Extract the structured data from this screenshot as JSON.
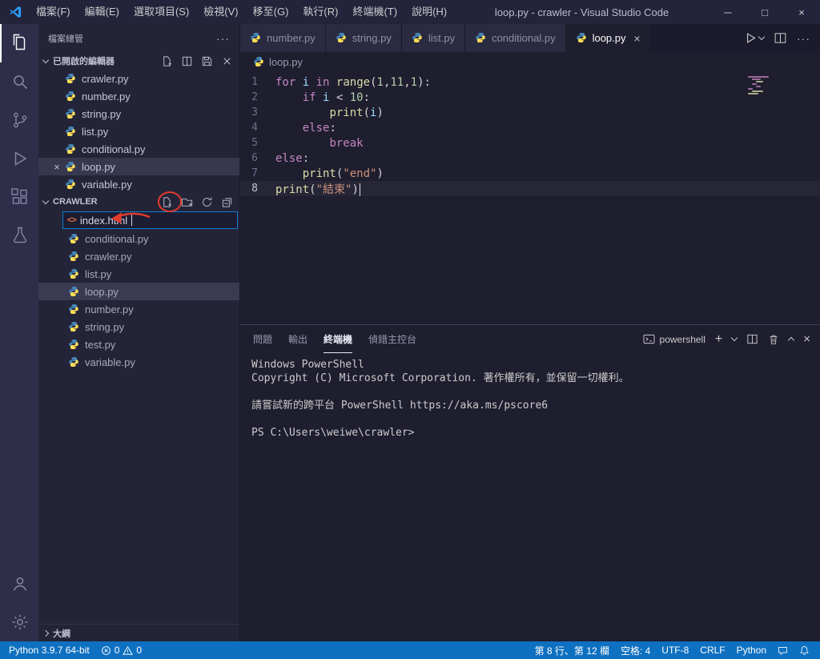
{
  "title_bar": {
    "menus": [
      "檔案(F)",
      "編輯(E)",
      "選取項目(S)",
      "檢視(V)",
      "移至(G)",
      "執行(R)",
      "終端機(T)",
      "說明(H)"
    ],
    "title": "loop.py - crawler - Visual Studio Code"
  },
  "sidebar": {
    "header": "檔案總管",
    "open_editors": {
      "label": "已開啟的編輯器",
      "items": [
        {
          "label": "crawler.py"
        },
        {
          "label": "number.py"
        },
        {
          "label": "string.py"
        },
        {
          "label": "list.py"
        },
        {
          "label": "conditional.py"
        },
        {
          "label": "loop.py",
          "active": true
        },
        {
          "label": "variable.py"
        }
      ]
    },
    "project": {
      "label": "CRAWLER",
      "new_file_value": "index.html",
      "items": [
        {
          "label": "conditional.py"
        },
        {
          "label": "crawler.py"
        },
        {
          "label": "list.py"
        },
        {
          "label": "loop.py",
          "selected": true
        },
        {
          "label": "number.py"
        },
        {
          "label": "string.py"
        },
        {
          "label": "test.py"
        },
        {
          "label": "variable.py"
        }
      ]
    },
    "outline_label": "大綱"
  },
  "tabs": {
    "items": [
      {
        "label": "number.py"
      },
      {
        "label": "string.py"
      },
      {
        "label": "list.py"
      },
      {
        "label": "conditional.py"
      },
      {
        "label": "loop.py",
        "active": true
      }
    ]
  },
  "editor": {
    "breadcrumb": "loop.py",
    "active_line": 8,
    "lines": [
      {
        "num": 1,
        "tokens": [
          [
            "kw",
            "for"
          ],
          [
            "pl",
            " "
          ],
          [
            "vr",
            "i"
          ],
          [
            "pl",
            " "
          ],
          [
            "kw",
            "in"
          ],
          [
            "pl",
            " "
          ],
          [
            "fn",
            "range"
          ],
          [
            "pl",
            "("
          ],
          [
            "nm",
            "1"
          ],
          [
            "pl",
            ","
          ],
          [
            "nm",
            "11"
          ],
          [
            "pl",
            ","
          ],
          [
            "nm",
            "1"
          ],
          [
            "pl",
            "):"
          ]
        ]
      },
      {
        "num": 2,
        "tokens": [
          [
            "pl",
            "    "
          ],
          [
            "kw",
            "if"
          ],
          [
            "pl",
            " "
          ],
          [
            "vr",
            "i"
          ],
          [
            "pl",
            " < "
          ],
          [
            "nm",
            "10"
          ],
          [
            "pl",
            ":"
          ]
        ]
      },
      {
        "num": 3,
        "tokens": [
          [
            "pl",
            "        "
          ],
          [
            "fn",
            "print"
          ],
          [
            "pl",
            "("
          ],
          [
            "vr",
            "i"
          ],
          [
            "pl",
            ")"
          ]
        ]
      },
      {
        "num": 4,
        "tokens": [
          [
            "pl",
            "    "
          ],
          [
            "kw",
            "else"
          ],
          [
            "pl",
            ":"
          ]
        ]
      },
      {
        "num": 5,
        "tokens": [
          [
            "pl",
            "        "
          ],
          [
            "kw",
            "break"
          ]
        ]
      },
      {
        "num": 6,
        "tokens": [
          [
            "kw",
            "else"
          ],
          [
            "pl",
            ":"
          ]
        ]
      },
      {
        "num": 7,
        "tokens": [
          [
            "pl",
            "    "
          ],
          [
            "fn",
            "print"
          ],
          [
            "pl",
            "("
          ],
          [
            "st",
            "\"end\""
          ],
          [
            "pl",
            ")"
          ]
        ]
      },
      {
        "num": 8,
        "tokens": [
          [
            "fn",
            "print"
          ],
          [
            "pl",
            "("
          ],
          [
            "st",
            "\"結束\""
          ],
          [
            "pl",
            ")"
          ]
        ]
      }
    ]
  },
  "panel": {
    "tabs": [
      {
        "label": "問題"
      },
      {
        "label": "輸出"
      },
      {
        "label": "終端機",
        "active": true
      },
      {
        "label": "偵錯主控台"
      }
    ],
    "shell_label": "powershell",
    "terminal_lines": [
      "Windows PowerShell",
      "Copyright (C) Microsoft Corporation. 著作權所有，並保留一切權利。",
      "",
      "請嘗試新的跨平台 PowerShell https://aka.ms/pscore6",
      "",
      "PS C:\\Users\\weiwe\\crawler>"
    ]
  },
  "status": {
    "python_version": "Python 3.9.7 64-bit",
    "errors": "0",
    "warnings": "0",
    "cursor": "第 8 行、第 12 欄",
    "spaces": "空格: 4",
    "encoding": "UTF-8",
    "eol": "CRLF",
    "language": "Python"
  },
  "colors": {
    "status_bar": "#0e70c1",
    "annotation_red": "#e23b2e",
    "keyword": "#c586c0",
    "string": "#ce9178",
    "number": "#b5cea8",
    "function": "#dcdcaa"
  }
}
